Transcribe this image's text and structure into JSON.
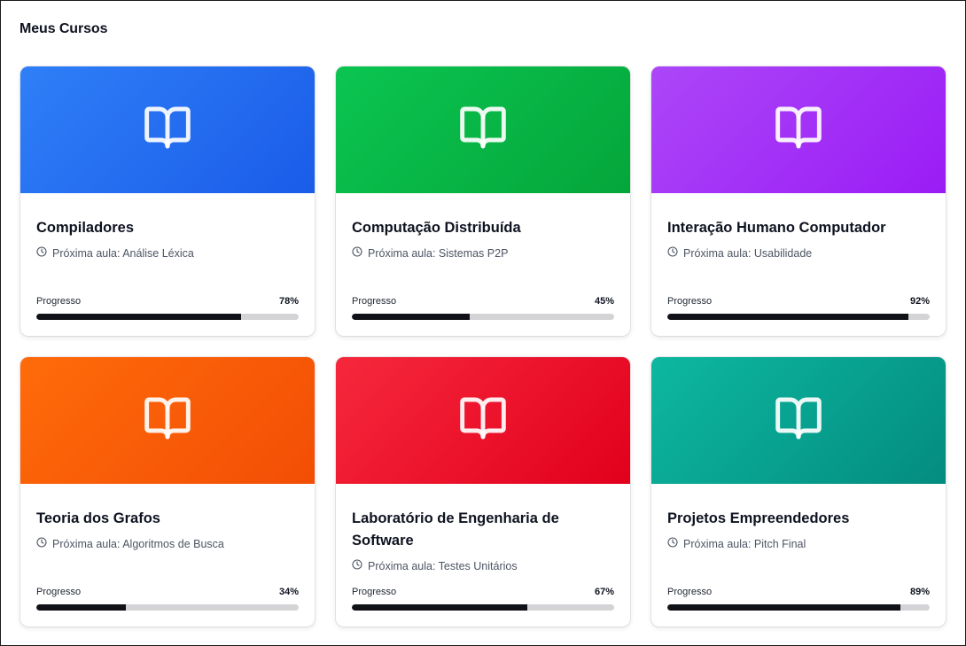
{
  "page": {
    "title": "Meus Cursos"
  },
  "labels": {
    "next_prefix": "Próxima aula: ",
    "progress": "Progresso"
  },
  "courses": [
    {
      "title": "Compiladores",
      "next_lesson": "Análise Léxica",
      "progress": 78,
      "progress_text": "78%",
      "gradient": [
        "#2f7ff8",
        "#1a5ce8"
      ],
      "icon": "book-open-icon"
    },
    {
      "title": "Computação Distribuída",
      "next_lesson": "Sistemas P2P",
      "progress": 45,
      "progress_text": "45%",
      "gradient": [
        "#0bc551",
        "#04a63a"
      ],
      "icon": "book-open-icon"
    },
    {
      "title": "Interação Humano Computador",
      "next_lesson": "Usabilidade",
      "progress": 92,
      "progress_text": "92%",
      "gradient": [
        "#ac47f8",
        "#9a1cf5"
      ],
      "icon": "book-open-icon"
    },
    {
      "title": "Teoria dos Grafos",
      "next_lesson": "Algoritmos de Busca",
      "progress": 34,
      "progress_text": "34%",
      "gradient": [
        "#ff6b0a",
        "#f24e05"
      ],
      "icon": "book-open-icon"
    },
    {
      "title": "Laboratório de Engenharia de Software",
      "next_lesson": "Testes Unitários",
      "progress": 67,
      "progress_text": "67%",
      "gradient": [
        "#f6283c",
        "#e2001c"
      ],
      "icon": "book-open-icon"
    },
    {
      "title": "Projetos Empreendedores",
      "next_lesson": "Pitch Final",
      "progress": 89,
      "progress_text": "89%",
      "gradient": [
        "#0db8a0",
        "#038c80"
      ],
      "icon": "book-open-icon"
    }
  ]
}
